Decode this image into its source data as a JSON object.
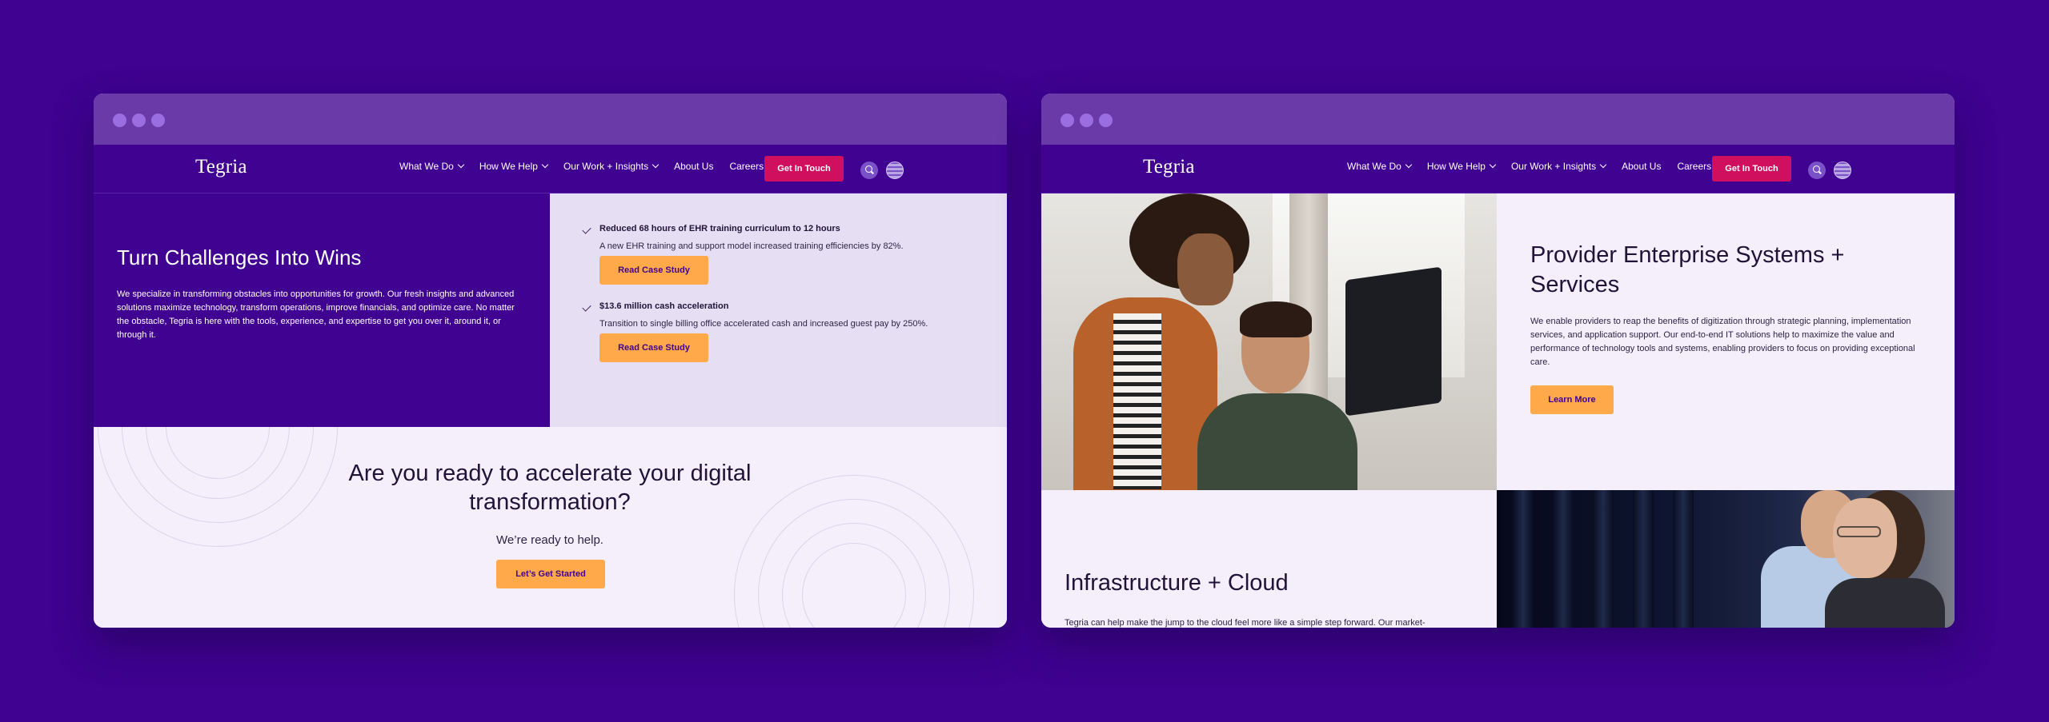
{
  "nav": {
    "logo": "Tegria",
    "items": [
      {
        "label": "What We Do",
        "has_dropdown": true
      },
      {
        "label": "How We Help",
        "has_dropdown": true
      },
      {
        "label": "Our Work + Insights",
        "has_dropdown": true
      },
      {
        "label": "About Us",
        "has_dropdown": false
      },
      {
        "label": "Careers",
        "has_dropdown": false
      }
    ],
    "cta_label": "Get In Touch",
    "search_icon": "search-icon",
    "language_icon": "globe-icon"
  },
  "left": {
    "hero": {
      "title": "Turn Challenges Into Wins",
      "body": "We specialize in transforming obstacles into opportunities for growth. Our fresh insights and advanced solutions maximize technology, transform operations, improve financials, and optimize care. No matter the obstacle, Tegria is here with the tools, experience, and expertise to get you over it, around it, or through it."
    },
    "cases": [
      {
        "title": "Reduced 68 hours of EHR training curriculum to 12 hours",
        "desc": "A new EHR training and support model increased training efficiencies by 82%.",
        "button": "Read Case Study"
      },
      {
        "title": "$13.6 million cash acceleration",
        "desc": "Transition to single billing office accelerated cash and increased guest pay by 250%.",
        "button": "Read Case Study"
      }
    ],
    "cta": {
      "title": "Are you ready to accelerate your digital transformation?",
      "subtitle": "We’re ready to help.",
      "button": "Let’s Get Started"
    }
  },
  "right": {
    "provider": {
      "title": "Provider Enterprise Systems + Services",
      "body": "We enable providers to reap the benefits of digitization through strategic planning, implementation services, and application support. Our end-to-end IT solutions help to maximize the value and performance of technology tools and systems, enabling providers to focus on providing exceptional care.",
      "button": "Learn More"
    },
    "infra": {
      "title": "Infrastructure + Cloud",
      "body": "Tegria can help make the jump to the cloud feel more like a simple step forward. Our market-"
    }
  },
  "colors": {
    "background": "#3f0291",
    "titlebar": "#6a3aa8",
    "accent_pink": "#d0105e",
    "accent_orange": "#ffa94a",
    "panel_light": "#f4effb",
    "panel_lavender": "#e6dff4"
  }
}
